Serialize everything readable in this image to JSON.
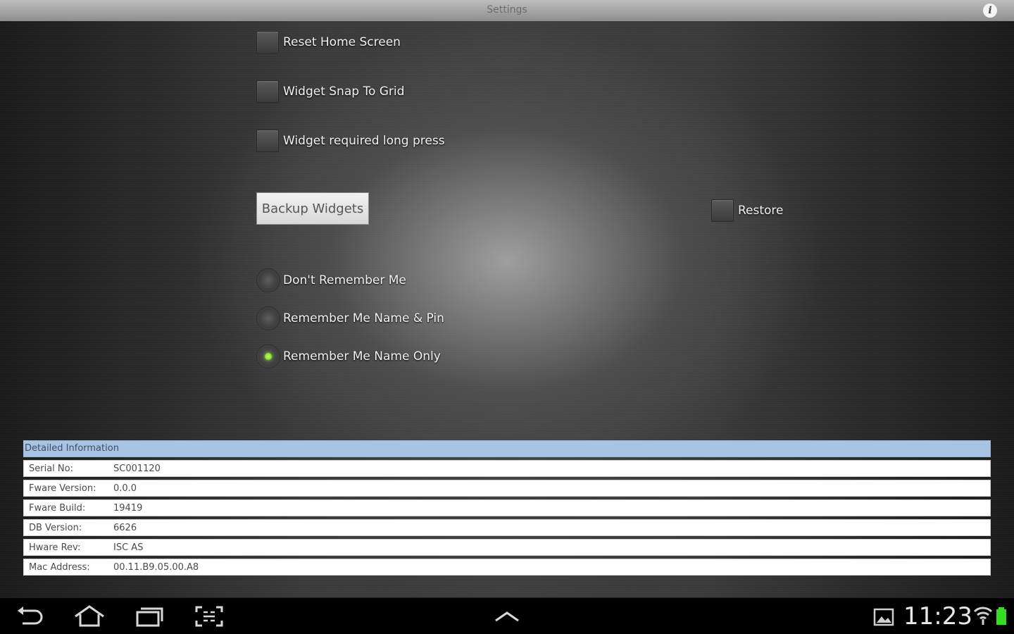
{
  "titlebar": {
    "title": "Settings",
    "info_glyph": "i"
  },
  "checkboxes": [
    {
      "label": "Reset Home Screen",
      "checked": false
    },
    {
      "label": "Widget Snap To Grid",
      "checked": false
    },
    {
      "label": "Widget required long press",
      "checked": false
    }
  ],
  "backup": {
    "button_label": "Backup Widgets",
    "restore_label": "Restore",
    "restore_checked": false
  },
  "remember": {
    "options": [
      {
        "label": "Don't Remember Me",
        "selected": false
      },
      {
        "label": "Remember Me Name & Pin",
        "selected": false
      },
      {
        "label": "Remember Me Name Only",
        "selected": true
      }
    ]
  },
  "details": {
    "header": "Detailed Information",
    "rows": [
      {
        "key": "Serial No:",
        "value": "SC001120"
      },
      {
        "key": "Fware Version:",
        "value": "0.0.0"
      },
      {
        "key": "Fware Build:",
        "value": "19419"
      },
      {
        "key": "DB Version:",
        "value": "6626"
      },
      {
        "key": "Hware Rev:",
        "value": "ISC AS"
      },
      {
        "key": "Mac Address:",
        "value": "00.11.B9.05.00.A8"
      }
    ]
  },
  "statusbar": {
    "time": "11:23",
    "accent_color": "#33dd22"
  },
  "icons": {
    "back": "back-icon",
    "home": "home-icon",
    "recent": "recent-apps-icon",
    "screenshot": "screenshot-icon",
    "up": "chevron-up-icon",
    "gallery": "gallery-icon",
    "wifi": "wifi-icon",
    "battery": "battery-icon"
  }
}
